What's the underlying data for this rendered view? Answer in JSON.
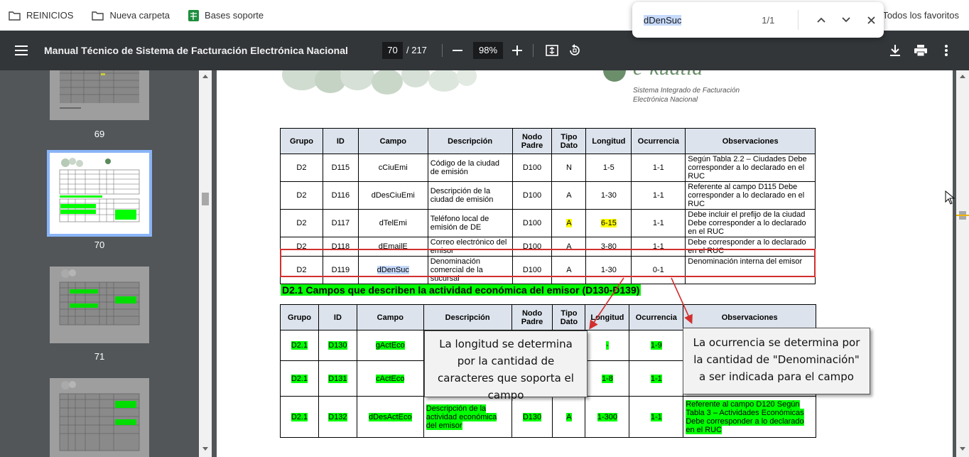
{
  "bookmarks": [
    {
      "label": "REINICIOS",
      "icon": "folder-icon"
    },
    {
      "label": "Nueva carpeta",
      "icon": "folder-icon"
    },
    {
      "label": "Bases soporte",
      "icon": "sheets-icon"
    }
  ],
  "bookmarks_right": "Todos los favoritos",
  "find": {
    "query": "dDenSuc",
    "count": "1/1"
  },
  "viewer": {
    "title": "Manual Técnico de Sistema de Facturación Electrónica Nacional",
    "page": "70",
    "total": "/ 217",
    "zoom": "98%"
  },
  "thumbnails": [
    {
      "label": "69"
    },
    {
      "label": "70"
    },
    {
      "label": "71"
    }
  ],
  "logo": {
    "line1": "Sistema Integrado de Facturación",
    "line2": "Electrónica Nacional",
    "brand": "e-kuatia"
  },
  "table1": {
    "headers": [
      "Grupo",
      "ID",
      "Campo",
      "Descripción",
      "Nodo Padre",
      "Tipo Dato",
      "Longitud",
      "Ocurrencia",
      "Observaciones"
    ],
    "rows": [
      [
        "D2",
        "D115",
        "cCiuEmi",
        "Código de la ciudad de emisión",
        "D100",
        "N",
        "1-5",
        "1-1",
        "Según Tabla 2.2 – Ciudades Debe corresponder a lo declarado en el RUC"
      ],
      [
        "D2",
        "D116",
        "dDesCiuEmi",
        "Descripción de la ciudad de emisión",
        "D100",
        "A",
        "1-30",
        "1-1",
        "Referente al campo D115 Debe corresponder a lo declarado en el RUC"
      ],
      [
        "D2",
        "D117",
        "dTelEmi",
        "Teléfono local de emisión de DE",
        "D100",
        "A",
        "6-15",
        "1-1",
        "Debe incluir el prefijo de la ciudad Debe corresponder a lo declarado en el RUC"
      ],
      [
        "D2",
        "D118",
        "dEmailE",
        "Correo electrónico del emisor",
        "D100",
        "A",
        "3-80",
        "1-1",
        "Debe corresponder a lo declarado en el RUC"
      ],
      [
        "D2",
        "D119",
        "dDenSuc",
        "Denominación comercial de la sucursal",
        "D100",
        "A",
        "1-30",
        "0-1",
        "Denominación interna del emisor"
      ]
    ]
  },
  "section_title": "D2.1 Campos que describen la actividad económica del emisor (D130-D139)",
  "table2": {
    "headers": [
      "Grupo",
      "ID",
      "Campo",
      "Descripción",
      "Nodo Padre",
      "Tipo Dato",
      "Longitud",
      "Ocurrencia",
      "Observaciones"
    ],
    "rows": [
      [
        "D2.1",
        "D130",
        "gActEco",
        "",
        "",
        "",
        "-",
        "1-9",
        ""
      ],
      [
        "D2.1",
        "D131",
        "cActEco",
        "",
        "",
        "",
        "1-8",
        "1-1",
        ""
      ],
      [
        "D2.1",
        "D132",
        "dDesActEco",
        "Descripción de la actividad económica del emisor",
        "D130",
        "A",
        "1-300",
        "1-1",
        "Referente al campo D120 Según Tabla 3 – Actividades Económicas Debe corresponder a lo declarado en el RUC"
      ]
    ]
  },
  "callouts": {
    "longitud": "La longitud se determina por la cantidad de caracteres que soporta el campo",
    "ocurrencia": "La ocurrencia se determina por la cantidad de \"Denominación\" a ser indicada para el campo"
  }
}
